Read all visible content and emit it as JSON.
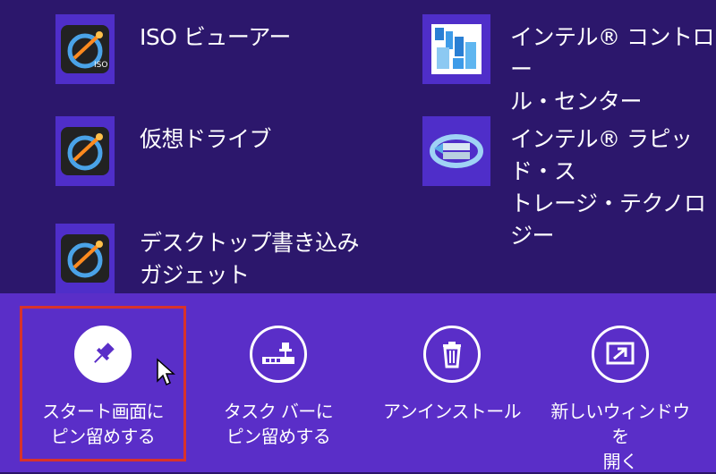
{
  "apps": [
    {
      "label": "ISO ビューアー",
      "icon": "iso-viewer-icon"
    },
    {
      "label": "仮想ドライブ",
      "icon": "virtual-drive-icon"
    },
    {
      "label": "デスクトップ書き込み\nガジェット",
      "icon": "desktop-burn-gadget-icon"
    },
    {
      "label": "インテル® コントロー\nル・センター",
      "icon": "intel-control-center-icon"
    },
    {
      "label": "インテル® ラピッド・ス\nトレージ・テクノロジー",
      "icon": "intel-rapid-storage-icon"
    }
  ],
  "appbar": {
    "pin_start": "スタート画面に\nピン留めする",
    "pin_taskbar": "タスク バーに\nピン留めする",
    "uninstall": "アンインストール",
    "new_window": "新しいウィンドウを\n開く"
  },
  "colors": {
    "background": "#2c176c",
    "appbar": "#5a2ec8",
    "tile": "#4f2ec9",
    "highlight": "#d8332b"
  }
}
